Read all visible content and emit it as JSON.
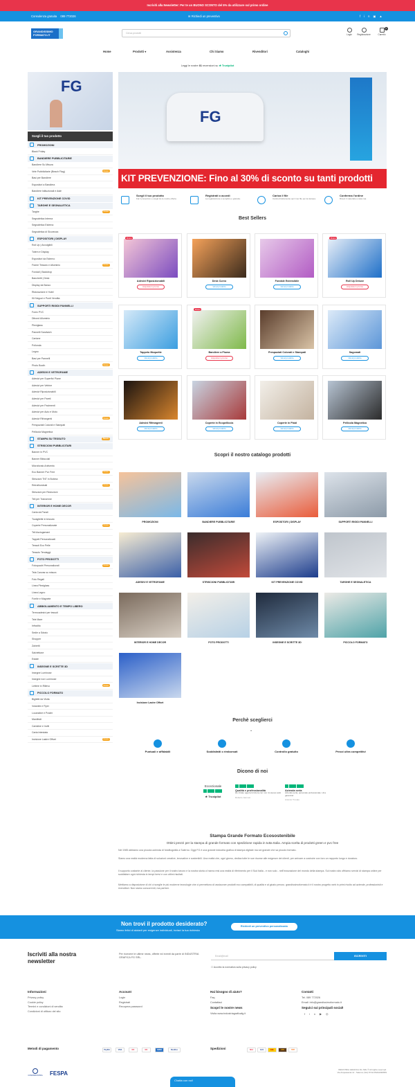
{
  "topbar": {
    "text": "Iscriviti alla Newsletter: Per te un BUONO SCONTO del 5% da utilizzare sul primo ordine"
  },
  "bluebar": {
    "consult": "Consulenza gratuita",
    "phone": "089 772026",
    "quote": "Richiedi un preventivo",
    "social": [
      "f",
      "in",
      "▣",
      "▲"
    ]
  },
  "header": {
    "logo_line1": "GRANDISSIMO",
    "logo_line2": "FORMATO.IT",
    "search_placeholder": "Cerca prodotti",
    "login": "Login",
    "register": "Registrazione",
    "cart": "Carrello",
    "cart_count": "0"
  },
  "nav": {
    "items": [
      "Home",
      "Prodotti ▾",
      "Assistenza",
      "Chi Siamo",
      "Rivenditori",
      "Cataloghi"
    ]
  },
  "trustpilot": {
    "text_before": "Leggi le nostre",
    "count": "81",
    "text_after": "recensioni su",
    "brand": "★ Trustpilot"
  },
  "sidebar": {
    "img_text": "FG",
    "header": "Scegli il tuo prodotto",
    "groups": [
      {
        "title": "PROMOZIONI",
        "items": [
          {
            "label": "Black Friday"
          }
        ]
      },
      {
        "title": "BANDIERE PUBBLICITARIE",
        "items": [
          {
            "label": "Bandiere Su Misura"
          },
          {
            "label": "Vele Pubblicitarie (Beach Flag)",
            "badge": "Nuovo"
          },
          {
            "label": "Basi per Bandiere"
          },
          {
            "label": "Espositori a Bandiera"
          },
          {
            "label": "Bandiere Istituzionali e Aste"
          }
        ]
      },
      {
        "title": "KIT PREVENZIONE COVID",
        "items": []
      },
      {
        "title": "TARGHE E SEGNALETICA",
        "items": [
          {
            "label": "Targhe",
            "badge": "Nuovo"
          },
          {
            "label": "Segnaletica Interna"
          },
          {
            "label": "Segnaletica Esterna"
          },
          {
            "label": "Segnaletica di Sicurezza"
          }
        ]
      },
      {
        "title": "ESPOSITORI | DISPLAY",
        "items": [
          {
            "label": "Roll Up | Avvolgibili"
          },
          {
            "label": "Totem e Display"
          },
          {
            "label": "Espositori da Esterno"
          },
          {
            "label": "Frame Tessuto e Alluminio",
            "badge": "Nuovo"
          },
          {
            "label": "Fondali | Backdrop"
          },
          {
            "label": "Banchetti | Desk"
          },
          {
            "label": "Display da Banco"
          },
          {
            "label": "Ristorazione e Hotel"
          },
          {
            "label": "Kit Negozi e Punti Vendita"
          }
        ]
      },
      {
        "title": "SUPPORTI RIGIDI PANNELLI",
        "items": [
          {
            "label": "Forex PVC"
          },
          {
            "label": "Dibond Alluminio"
          },
          {
            "label": "Plexiglass"
          },
          {
            "label": "Pannelli Sandwich"
          },
          {
            "label": "Cartone"
          },
          {
            "label": "Polionda"
          },
          {
            "label": "Legno"
          },
          {
            "label": "Basi per Pannelli"
          },
          {
            "label": "Photo Booth",
            "badge": "Nuovo"
          }
        ]
      },
      {
        "title": "ADESIVI E VETROFANIE",
        "items": [
          {
            "label": "Adesivi per Superfici Piane"
          },
          {
            "label": "Adesivi per Vetrine"
          },
          {
            "label": "Adesivi Riposizionabili"
          },
          {
            "label": "Adesivi per Pareti"
          },
          {
            "label": "Adesivi per Pavimenti"
          },
          {
            "label": "Adesivi per Auto e Moto"
          },
          {
            "label": "Adesivi Rifrangenti",
            "badge": "Nuovo"
          },
          {
            "label": "Prespaziati Colorati e Stampati"
          },
          {
            "label": "Pellicola Magnetica"
          }
        ]
      },
      {
        "title": "STAMPA SU TESSUTO",
        "items": [],
        "badge": "Nuovo"
      },
      {
        "title": "STRISCIONI PUBBLICITARI",
        "items": [
          {
            "label": "Banner in PVC"
          },
          {
            "label": "Banner Bifacciali"
          },
          {
            "label": "Microforato Antivento"
          },
          {
            "label": "Eco Banner Pvc Free",
            "badge": "Nuovo"
          },
          {
            "label": "Striscioni TNT in Bobina"
          },
          {
            "label": "Retroilluminati",
            "badge": "Nuovo"
          },
          {
            "label": "Striscioni per Recinzioni"
          },
          {
            "label": "Teli per Transenne"
          }
        ]
      },
      {
        "title": "INTERIOR E HOME DECOR",
        "items": [
          {
            "label": "Carta da Parati"
          },
          {
            "label": "Tovagliette in tessuto"
          },
          {
            "label": "Coperte Personalizzate",
            "badge": "Nuovo"
          },
          {
            "label": "Teli Asciugamani"
          },
          {
            "label": "Tappeti Personalizzati"
          },
          {
            "label": "Tessuti Eco Pelle"
          },
          {
            "label": "Tessuto Tendaggi"
          }
        ]
      },
      {
        "title": "FOTO PRODOTTI",
        "items": [
          {
            "label": "Fotoquadri Personalizzati",
            "badge": "Nuovo"
          },
          {
            "label": "Tela Canvas su misura"
          },
          {
            "label": "Foto Regali"
          },
          {
            "label": "Linea Plexiglass"
          },
          {
            "label": "Linea Legno"
          },
          {
            "label": "Forrile e Magnete"
          }
        ]
      },
      {
        "title": "ABBIGLIAMENTO E TEMPO LIBERO",
        "items": [
          {
            "label": "Termoadesivi per tessuti"
          },
          {
            "label": "Tele Mare"
          },
          {
            "label": "Infradito"
          },
          {
            "label": "Sedie a Sdraio"
          },
          {
            "label": "Shopper"
          },
          {
            "label": "Zainetti"
          },
          {
            "label": "Salviettone"
          },
          {
            "label": "Estate"
          }
        ]
      },
      {
        "title": "INSEGNE E SCRITTE 3D",
        "items": [
          {
            "label": "Insegne Luminose"
          },
          {
            "label": "Insegne non Luminose"
          },
          {
            "label": "Lettere in Rilievo",
            "badge": "Nuovo"
          }
        ]
      },
      {
        "title": "PICCOLO FORMATO",
        "items": [
          {
            "label": "Biglietti da Visita"
          },
          {
            "label": "Volantini e Flyer"
          },
          {
            "label": "Locandine e Poster"
          },
          {
            "label": "Manifesti"
          },
          {
            "label": "Cartoline e Inviti"
          },
          {
            "label": "Carta Intestata"
          },
          {
            "label": "Incisione Lastre Offset",
            "badge": "Nuovo"
          }
        ]
      }
    ]
  },
  "hero": {
    "logo": "FG",
    "banner": "KIT PREVENZIONE: Fino al 30% di sconto su tanti prodotti"
  },
  "steps": [
    {
      "title": "Scegli il tuo prodotto",
      "desc": "Fai il preventivo e scegli tra le nostre offerte."
    },
    {
      "title": "Registrati o accedi",
      "desc": "La registrazione è semplice e gratuita."
    },
    {
      "title": "Carica il file",
      "desc": "Carica direttamente qui il tuo file per la stampa."
    },
    {
      "title": "Conferma l'ordine",
      "desc": "Ricevi il materiale a casa tua."
    }
  ],
  "best": {
    "title": "Best Sellers",
    "products": [
      {
        "name": "Adesivi Riposizionabili",
        "btn": "Acquista in promo",
        "promo": true,
        "tag": "Promo",
        "c1": "#f4c6d6",
        "c2": "#7b4cc0"
      },
      {
        "name": "Desk Curvo",
        "btn": "Vai al prodotto",
        "promo": false,
        "c1": "#f5a25a",
        "c2": "#3a2a1c"
      },
      {
        "name": "Fondale Estensibile",
        "btn": "Vai al prodotto",
        "promo": false,
        "c1": "#e7c9e9",
        "c2": "#b25cc4"
      },
      {
        "name": "Roll Up Deluxe",
        "btn": "Acquista in promo",
        "promo": true,
        "tag": "Promo",
        "c1": "#e7eef7",
        "c2": "#1e6fc8"
      },
      {
        "name": "Tappeto Moquette",
        "btn": "Vai al prodotto",
        "promo": false,
        "c1": "#d5e9f8",
        "c2": "#3b9ee0"
      },
      {
        "name": "Bandiere a Piuma",
        "btn": "Acquista in promo",
        "promo": true,
        "tag": "Promo",
        "c1": "#f1f1f1",
        "c2": "#7fb94a"
      },
      {
        "name": "Prespaziati Colorati e Stampati",
        "btn": "Vai al prodotto",
        "promo": false,
        "c1": "#5a3d2c",
        "c2": "#d9c3a6"
      },
      {
        "name": "Sagomati",
        "btn": "Vai al prodotto",
        "promo": false,
        "c1": "#dceaf8",
        "c2": "#5c96d8"
      },
      {
        "name": "Adesivi Rifrangenti",
        "btn": "Vai al prodotto",
        "promo": false,
        "c1": "#1a1310",
        "c2": "#d9862e"
      },
      {
        "name": "Coperte in Ecopelliccia",
        "btn": "Vai al prodotto",
        "promo": false,
        "c1": "#c8d4e2",
        "c2": "#a83a3a"
      },
      {
        "name": "Coperte in Plaid",
        "btn": "Vai al prodotto",
        "promo": false,
        "c1": "#f2efe9",
        "c2": "#c4b3a0"
      },
      {
        "name": "Pellicola Magnetica",
        "btn": "Vai al prodotto",
        "promo": false,
        "c1": "#b7c4d3",
        "c2": "#2b2b2b"
      }
    ]
  },
  "catalog": {
    "title": "Scopri il nostro catalogo prodotti",
    "items": [
      {
        "name": "PROMOZIONI",
        "c1": "#f6c39a",
        "c2": "#7ab8e8"
      },
      {
        "name": "BANDIERE PUBBLICITARIE",
        "c1": "#c9d8ec",
        "c2": "#3b7dd8"
      },
      {
        "name": "ESPOSITORI | DISPLAY",
        "c1": "#e8eef5",
        "c2": "#e95c3a"
      },
      {
        "name": "SUPPORTI RIGIDI PANNELLI",
        "c1": "#dde3ea",
        "c2": "#8c9aa8"
      },
      {
        "name": "ADESIVI E VETROFANIE",
        "c1": "#f7ecd2",
        "c2": "#3a5fa8"
      },
      {
        "name": "STRISCIONI PUBBLICITARI",
        "c1": "#3a2c2c",
        "c2": "#c24a3a"
      },
      {
        "name": "KIT PREVENZIONE COVID",
        "c1": "#eef2f6",
        "c2": "#1c3c8c"
      },
      {
        "name": "TARGHE E SEGNALETICA",
        "c1": "#bfc5cc",
        "c2": "#e1e4e8"
      },
      {
        "name": "INTERIOR E HOME DECOR",
        "c1": "#7a6a5c",
        "c2": "#d8cfc4"
      },
      {
        "name": "FOTO PRODOTTI",
        "c1": "#f3efe8",
        "c2": "#b7d1e6"
      },
      {
        "name": "INSEGNE E SCRITTE 3D",
        "c1": "#1f2a3c",
        "c2": "#6e8aa8"
      },
      {
        "name": "PICCOLO FORMATO",
        "c1": "#eceae6",
        "c2": "#4fa3a8"
      },
      {
        "name": "Incisione Lastre Offset",
        "c1": "#2b5fc8",
        "c2": "#c9d8ee"
      }
    ]
  },
  "why": {
    "title": "Perchè sceglierci",
    "items": [
      "Puntuali e affidabili",
      "Soddisfatti o rimborsati",
      "Controllo gratuito",
      "Prezzi ultra competitivi"
    ]
  },
  "reviews": {
    "title": "Dicono di noi",
    "rating": "Eccezionale",
    "brand": "Trustpilot",
    "items": [
      {
        "title": "Qualità e professionalità",
        "text": "Ho ritirato oggi la fornitura con non mi aveva vanti",
        "author": "Roberto Jammel"
      },
      {
        "title": "Azienda seria",
        "text": "Azienda seria, personale professionale. Una garanzia!",
        "author": "Antonio Trovato"
      }
    ]
  },
  "eco": {
    "title": "Stampa Grande Formato Ecosostenibile",
    "subtitle": "Ottimi prezzi per la stampa di grande formato con spedizione rapida in tutta Italia. Ampia scelta di prodotti green e pvc free",
    "p1": "Nel 1985 abbiamo una piccola azienda di fotolitografia a Salerno. Oggi FG è una grande industria grafica di stampa digitale ma sei grande che sa piccolo formato.",
    "p2": "Siamo una realtà moderna fatta di soluzioni creative, innovative e sostenibili. Una realtà che, ogni giorno, dedica tutte le sue risorse alle esigenze dei clienti, per arrivare a costruire con loro un rapporto lungo e duraturo.",
    "p3": "Il supporto costante al cliente, la passione per il nostro lavoro e la nostra storia ci hanno resi una realtà di riferimento per il Sud Italia - e non solo - nell'innovazione del mondo della stampa. Sul nostro sito offriamo servizi di stampa online per soddisfare ogni richiesta in tempi brevi e con ottimi risultati.",
    "p4": "Mettiamo a disposizione di chi ci sceglie le più moderne tecnologie che ci permettono di assicurare prodotti eco compatibili, di qualità e al giusto prezzo. grandissimoformato.it è il nostro progetto web in primi rivolto ad aziende, professionisti e rivenditori. Non siamo concorrenti, ma partner."
  },
  "cta": {
    "title": "Non trovi il prodotto desiderato?",
    "subtitle": "Siamo felici di aiutarti per esigenze individuali, inviaci la tua richiesta",
    "button": "Richiedi un preventivo personalizzato"
  },
  "newsletter": {
    "title": "Iscriviti alla nostra newsletter",
    "desc": "Per ricevere le ultime news, offerte ed eventi da parte di INDUSTRIA GRAFICA FG SRL.",
    "placeholder": "Email@mail",
    "button": "ISCRIVITI",
    "privacy": "Accetto la normativa sulla privacy policy"
  },
  "footer": {
    "info": {
      "title": "Informazioni",
      "links": [
        "Privacy policy",
        "Cookie policy",
        "Termini e condizioni di vendita",
        "Condizioni di utilizzo del sito"
      ]
    },
    "account": {
      "title": "Account",
      "links": [
        "Login",
        "Registrati",
        "Recupera password"
      ]
    },
    "help": {
      "title": "Hai bisogno di aiuto?",
      "links": [
        "Faq",
        "Contattaci"
      ],
      "news_title": "Scopri le nostre news",
      "news_link": "Visita www.industriagraficafg.it"
    },
    "contacts": {
      "title": "Contatti",
      "tel": "Tel. 089 772026",
      "email": "Email: info@grandissimoformato.it",
      "social_title": "Seguici sui principali social!",
      "social": [
        "f",
        "in",
        "▶",
        "◎"
      ]
    },
    "payments_title": "Metodi di pagamento",
    "payments": [
      "PayPal",
      "VISA",
      "MC",
      "MC",
      "AMEX",
      "Bonifico"
    ],
    "shipping_title": "Spedizioni",
    "carriers": [
      "SDA",
      "GLS",
      "DHL",
      "UPS",
      "TNT"
    ],
    "brands": [
      "CONFINDUSTRIA",
      "FESPA"
    ],
    "legal1": "INDUSTRIA GRAFICA FG SRL ® All rights reserved.",
    "legal2": "Via Acquasanta 11 - Salerno (SA) P.IVA 05242290659"
  },
  "chat": "Chatta con noi!",
  "colors": {
    "red": "#e8344b",
    "blue": "#1591e0",
    "dark": "#3a3a3a"
  }
}
